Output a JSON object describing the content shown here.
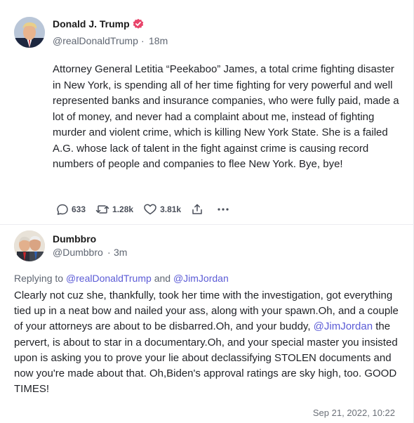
{
  "post": {
    "author_name": "Donald J. Trump",
    "handle": "@realDonaldTrump",
    "separator": "·",
    "time": "18m",
    "text": "Attorney General Letitia “Peekaboo” James, a total crime fighting disaster in New York, is spending all of her time fighting for very powerful and well represented banks and insurance companies, who were fully paid, made a lot of money, and never had a complaint about me, instead of fighting murder and violent crime, which is killing New York State. She is a failed A.G. whose lack of talent in the fight against crime is causing record numbers of people and companies to flee New York. Bye, bye!",
    "actions": {
      "reply_count": "633",
      "retruth_count": "1.28k",
      "like_count": "3.81k",
      "share_icon": "share-icon",
      "more_icon": "more-icon"
    },
    "colors": {
      "verified": "#e8456b",
      "link": "#5b5bd6"
    }
  },
  "reply": {
    "author_name": "Dumbbro",
    "handle": "@Dumbbro",
    "separator": "·",
    "time": "3m",
    "replying_prefix": "Replying to",
    "replying_user1": "@realDonaldTrump",
    "replying_and": "and",
    "replying_user2": "@JimJordan",
    "text_part1": "Clearly not cuz she, thankfully, took her time with the investigation, got everything tied up in a neat bow and nailed your ass, along with your spawn.Oh, and a couple of your attorneys are about to be disbarred.Oh, and your buddy,",
    "mention": "@JimJordan",
    "text_part2": "the pervert, is about to star in a documentary.Oh, and your special master you insisted upon is asking you to prove your lie about declassifying STOLEN documents and now you're made about that. Oh,Biden's approval ratings are sky high, too. GOOD TIMES!",
    "timestamp": "Sep 21, 2022, 10:22"
  }
}
